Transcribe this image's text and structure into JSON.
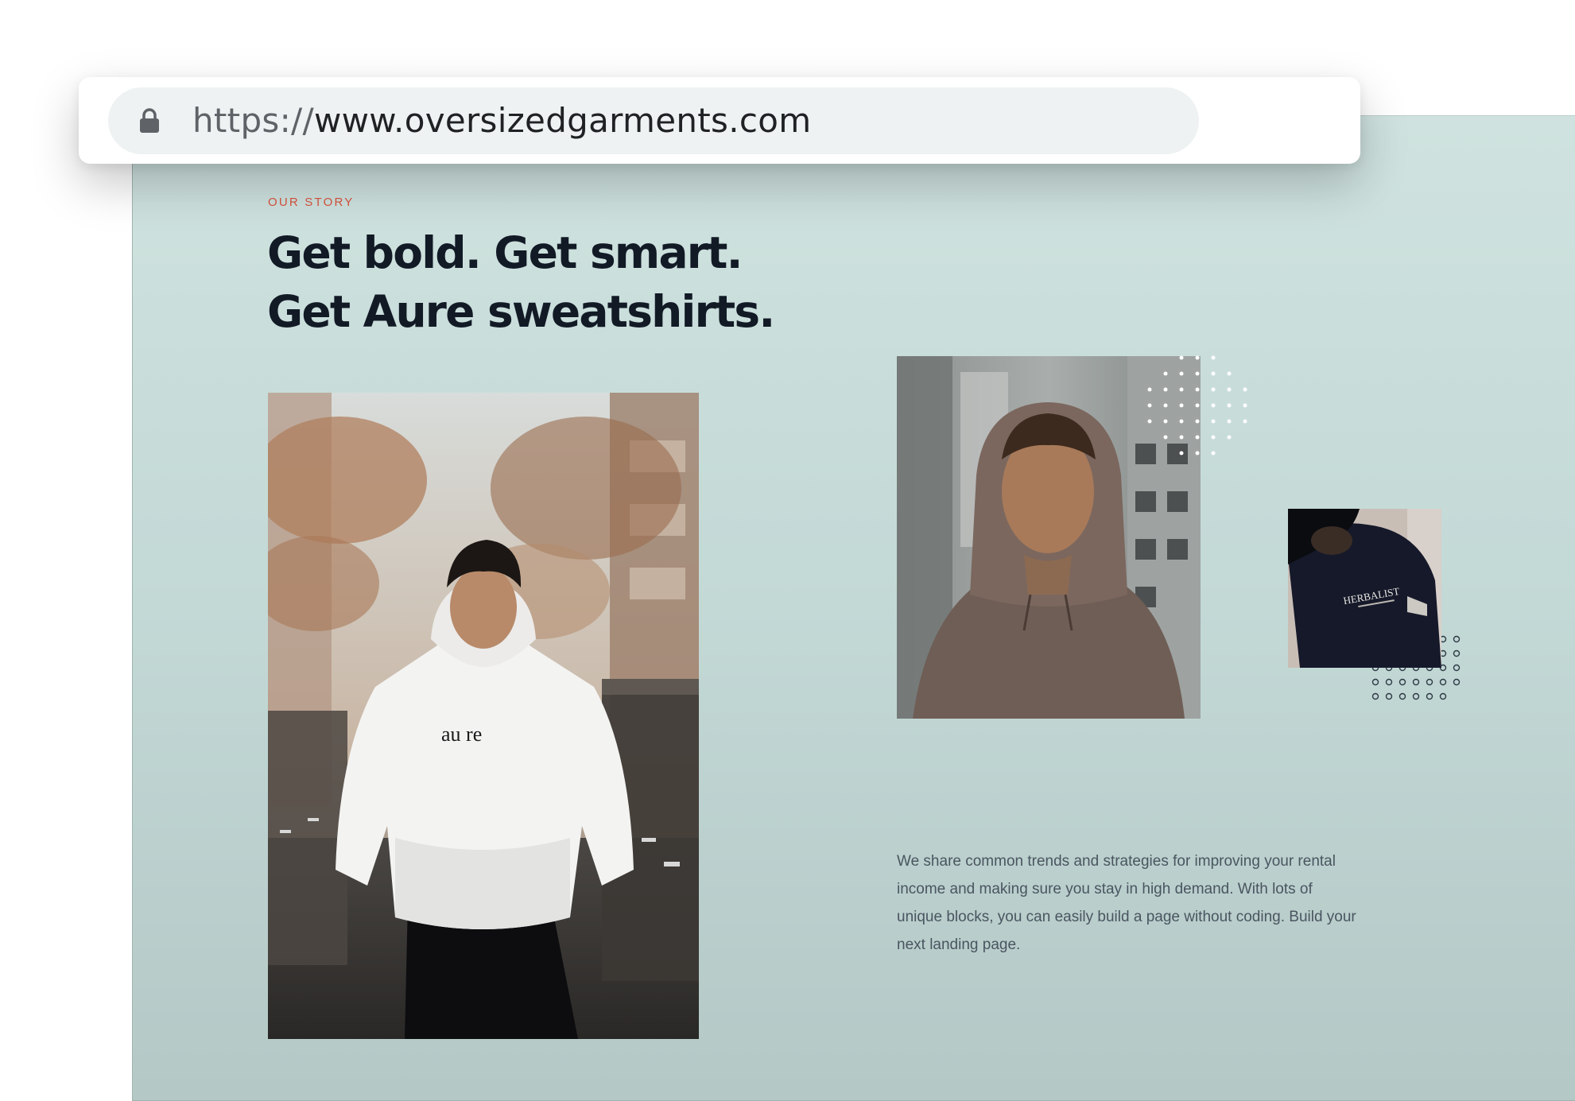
{
  "browser": {
    "url_scheme": "https://",
    "url_host": "www.oversizedgarments.com",
    "lock_icon": "lock-icon"
  },
  "section": {
    "eyebrow": "OUR STORY",
    "headline_line1": "Get bold. Get smart.",
    "headline_line2": "Get Aure sweatshirts.",
    "body": "We share common trends and strategies for improving your rental income and making sure you stay in high demand. With lots of unique blocks, you can easily build a page without coding. Build your next landing page."
  },
  "photos": {
    "main_shirt_text": "au re",
    "small_shirt_text": "HERBALIST"
  },
  "colors": {
    "accent": "#d9533f",
    "headline": "#121a26",
    "background": "#c6dbd8",
    "body_text": "#4a5560"
  }
}
